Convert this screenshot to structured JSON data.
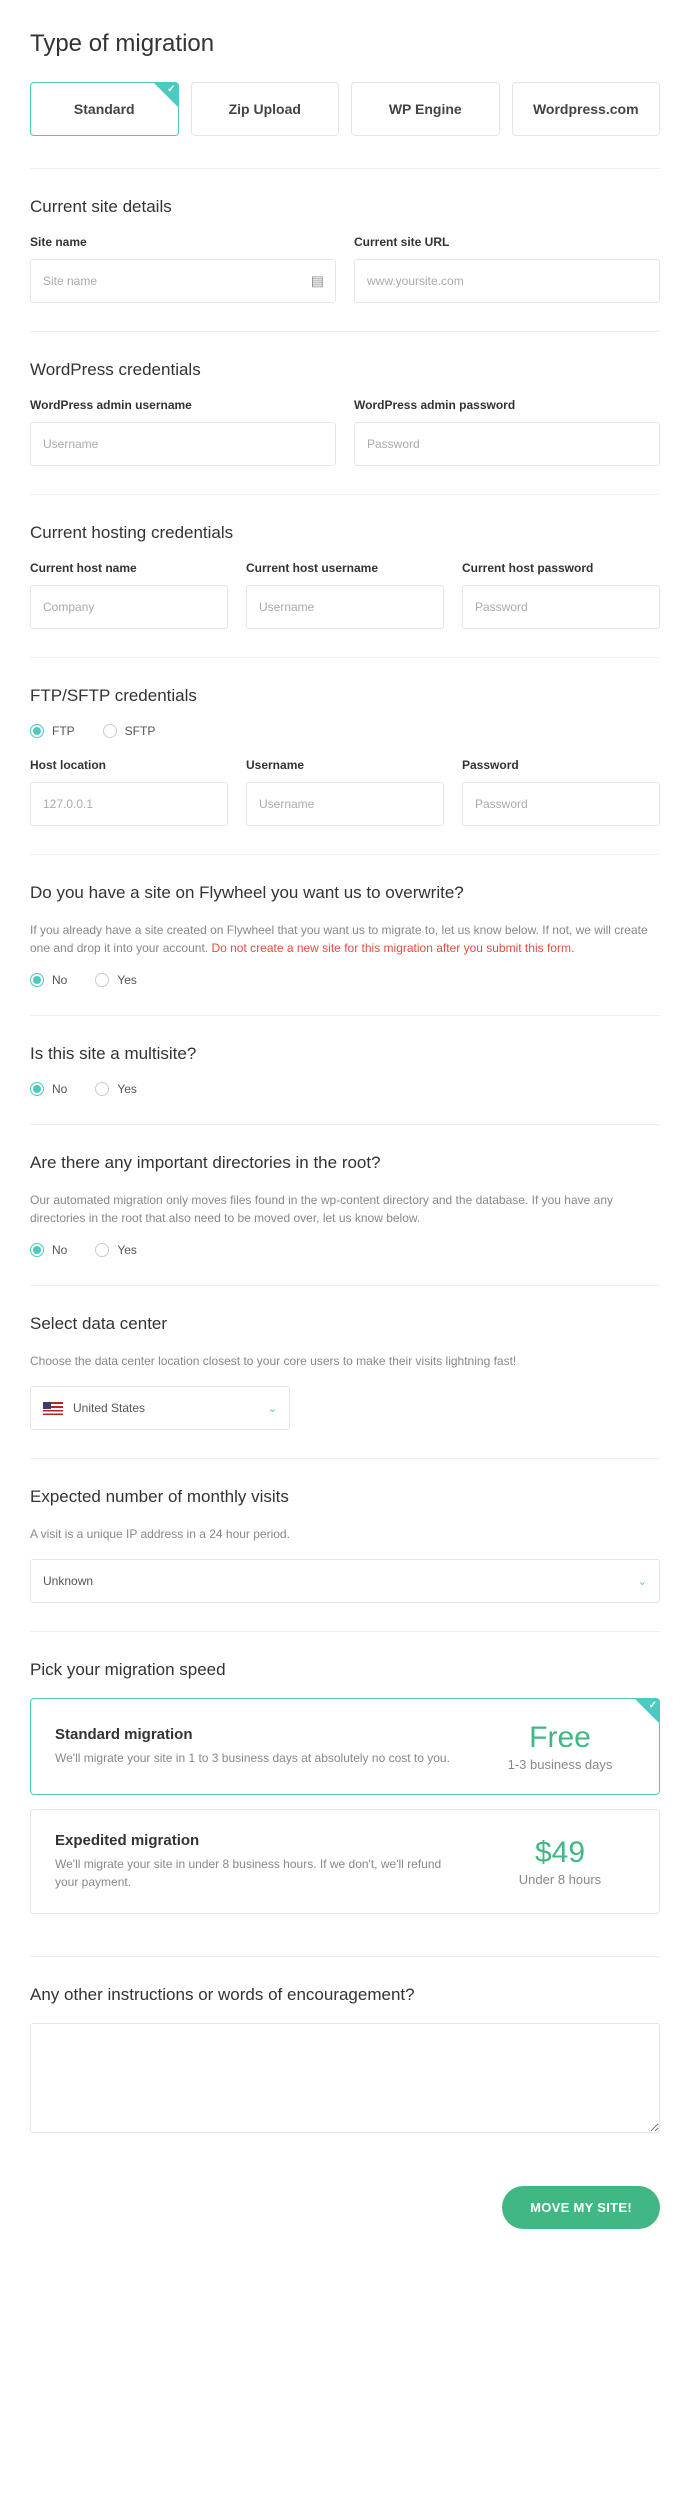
{
  "title": "Type of migration",
  "tabs": [
    "Standard",
    "Zip Upload",
    "WP Engine",
    "Wordpress.com"
  ],
  "sections": {
    "siteDetails": {
      "title": "Current site details",
      "siteName": {
        "label": "Site name",
        "placeholder": "Site name"
      },
      "siteUrl": {
        "label": "Current site URL",
        "placeholder": "www.yoursite.com"
      }
    },
    "wpCreds": {
      "title": "WordPress credentials",
      "user": {
        "label": "WordPress admin username",
        "placeholder": "Username"
      },
      "pass": {
        "label": "WordPress admin password",
        "placeholder": "Password"
      }
    },
    "hostCreds": {
      "title": "Current hosting credentials",
      "host": {
        "label": "Current host name",
        "placeholder": "Company"
      },
      "user": {
        "label": "Current host username",
        "placeholder": "Username"
      },
      "pass": {
        "label": "Current host password",
        "placeholder": "Password"
      }
    },
    "ftp": {
      "title": "FTP/SFTP credentials",
      "optFtp": "FTP",
      "optSftp": "SFTP",
      "host": {
        "label": "Host location",
        "placeholder": "127.0.0.1"
      },
      "user": {
        "label": "Username",
        "placeholder": "Username"
      },
      "pass": {
        "label": "Password",
        "placeholder": "Password"
      }
    },
    "overwrite": {
      "title": "Do you have a site on Flywheel you want us to overwrite?",
      "desc1": "If you already have a site created on Flywheel that you want us to migrate to, let us know below. If not, we will create one and drop it into your account. ",
      "desc2": "Do not create a new site for this migration after you submit this form.",
      "no": "No",
      "yes": "Yes"
    },
    "multisite": {
      "title": "Is this site a multisite?",
      "no": "No",
      "yes": "Yes"
    },
    "rootDirs": {
      "title": "Are there any important directories in the root?",
      "desc": "Our automated migration only moves files found in the wp-content directory and the database. If you have any directories in the root that also need to be moved over, let us know below.",
      "no": "No",
      "yes": "Yes"
    },
    "dataCenter": {
      "title": "Select data center",
      "desc": "Choose the data center location closest to your core users to make their visits lightning fast!",
      "value": "United States"
    },
    "visits": {
      "title": "Expected number of monthly visits",
      "desc": "A visit is a unique IP address in a 24 hour period.",
      "value": "Unknown"
    },
    "speed": {
      "title": "Pick your migration speed",
      "standard": {
        "title": "Standard migration",
        "desc": "We'll migrate your site in 1 to 3 business days at absolutely no cost to you.",
        "price": "Free",
        "time": "1-3 business days"
      },
      "expedited": {
        "title": "Expedited migration",
        "desc": "We'll migrate your site in under 8 business hours. If we don't, we'll refund your payment.",
        "price": "$49",
        "time": "Under 8 hours"
      }
    },
    "notes": {
      "title": "Any other instructions or words of encouragement?"
    }
  },
  "submit": "MOVE MY SITE!"
}
